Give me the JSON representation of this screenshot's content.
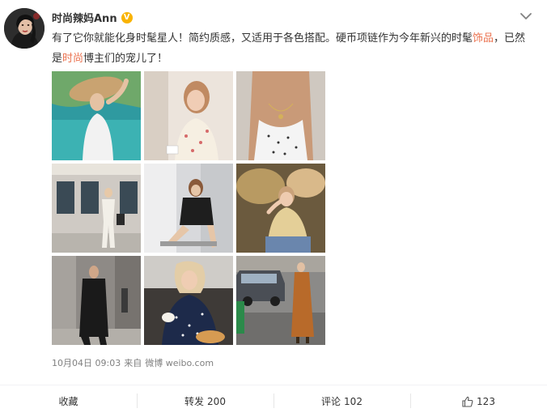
{
  "post": {
    "username": "时尚辣妈Ann",
    "verified_badge": "V",
    "text_segments": {
      "s1": "有了它你就能化身时髦星人！简约质感，又适用于各色搭配。硬币项链作为今年新兴的时髦",
      "s2": "饰品",
      "s3": "，已然是",
      "s4": "时尚",
      "s5": "博主们的宠儿了！"
    },
    "date": "10月04日 09:03",
    "from_label": "来自",
    "source": "微博 weibo.com"
  },
  "actions": {
    "favorite": "收藏",
    "repost_label": "转发",
    "repost_count": "200",
    "comment_label": "评论",
    "comment_count": "102",
    "like_count": "123"
  },
  "icons": {
    "verified": "verified-icon",
    "more": "chevron-down-icon",
    "like": "thumbs-up-icon"
  },
  "colors": {
    "highlight": "#eb7350",
    "verified": "#f9b300",
    "meta_text": "#808080"
  }
}
